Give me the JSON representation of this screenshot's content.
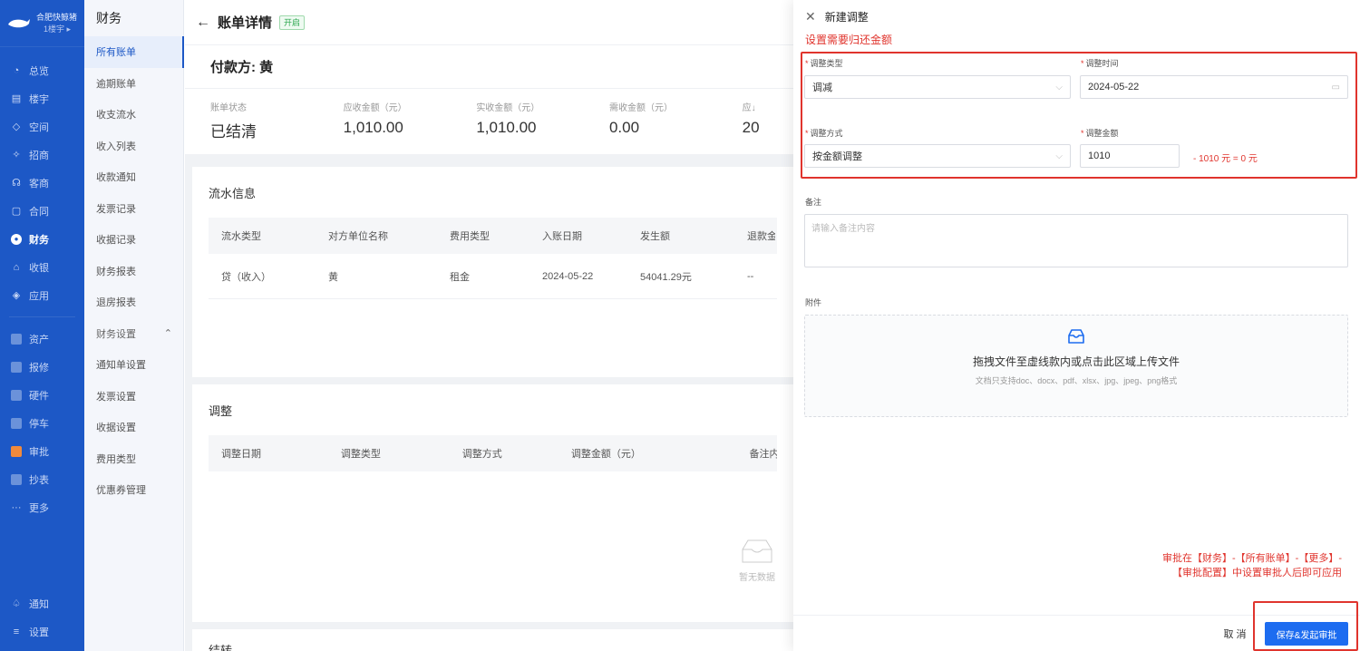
{
  "rail": {
    "logo": "合肥快鲸猪",
    "building": "1楼宇",
    "building_chevron": "▸",
    "items": [
      {
        "label": "总览",
        "icon": "◔"
      },
      {
        "label": "楼宇",
        "icon": "▤"
      },
      {
        "label": "空间",
        "icon": "◇"
      },
      {
        "label": "招商",
        "icon": "✧"
      },
      {
        "label": "客商",
        "icon": "☊"
      },
      {
        "label": "合同",
        "icon": "▢"
      },
      {
        "label": "财务",
        "icon": "●"
      },
      {
        "label": "收银",
        "icon": "⌂"
      },
      {
        "label": "应用",
        "icon": "◈"
      }
    ],
    "extras": [
      "资产",
      "报修",
      "硬件",
      "停车",
      "审批",
      "抄表",
      "更多"
    ],
    "more_dots": "···",
    "notify": "通知",
    "notify_icon": "♤",
    "settings": "设置",
    "settings_icon": "≡"
  },
  "subnav": {
    "title": "财务",
    "items": [
      "所有账单",
      "逾期账单",
      "收支流水",
      "收入列表",
      "收款通知",
      "发票记录",
      "收据记录",
      "财务报表",
      "退房报表"
    ],
    "group": "财务设置",
    "group_chevron": "⌃",
    "group_items": [
      "通知单设置",
      "发票设置",
      "收据设置",
      "费用类型",
      "优惠券管理"
    ]
  },
  "main": {
    "back": "←",
    "title": "账单详情",
    "tag": "开启",
    "payer": "付款方: 黄",
    "stats": [
      {
        "k": "账单状态",
        "v": "已结清"
      },
      {
        "k": "应收金额（元）",
        "v": "1,010.00"
      },
      {
        "k": "实收金额（元）",
        "v": "1,010.00"
      },
      {
        "k": "需收金额（元）",
        "v": "0.00"
      },
      {
        "k": "应↓",
        "v": "20"
      }
    ],
    "flow": {
      "title": "流水信息",
      "headers": [
        "流水类型",
        "对方单位名称",
        "费用类型",
        "入账日期",
        "发生额",
        "退款金额"
      ],
      "rows": [
        [
          "贷（收入）",
          "黄",
          "租金",
          "2024-05-22",
          "54041.29元",
          "--"
        ]
      ]
    },
    "adjust": {
      "title": "调整",
      "headers": [
        "调整日期",
        "调整类型",
        "调整方式",
        "调整金额（元）",
        "备注内"
      ],
      "empty": "暂无数据"
    },
    "bottom_title": "结转"
  },
  "drawer": {
    "close": "✕",
    "title": "新建调整",
    "hint": "设置需要归还金额",
    "type_label": "调整类型",
    "type_value": "调减",
    "date_label": "调整时间",
    "date_value": "2024-05-22",
    "method_label": "调整方式",
    "method_value": "按金额调整",
    "amount_label": "调整金额",
    "amount_value": "1010",
    "calc": "- 1010 元 = 0 元",
    "remark_label": "备注",
    "remark_placeholder": "请输入备注内容",
    "attach_label": "附件",
    "upload_title": "拖拽文件至虚线款内或点击此区域上传文件",
    "upload_sub": "文档只支持doc、docx、pdf、xlsx、jpg、jpeg、png格式",
    "note_line1": "审批在【财务】-【所有账单】-【更多】-",
    "note_line2": "【审批配置】中设置审批人后即可应用",
    "cancel": "取 消",
    "submit": "保存&发起审批"
  },
  "colors": {
    "brand": "#1d58c6",
    "primary_button": "#1d6cf0",
    "annotation_red": "#e0342d",
    "tag_green": "#2aa64d"
  }
}
